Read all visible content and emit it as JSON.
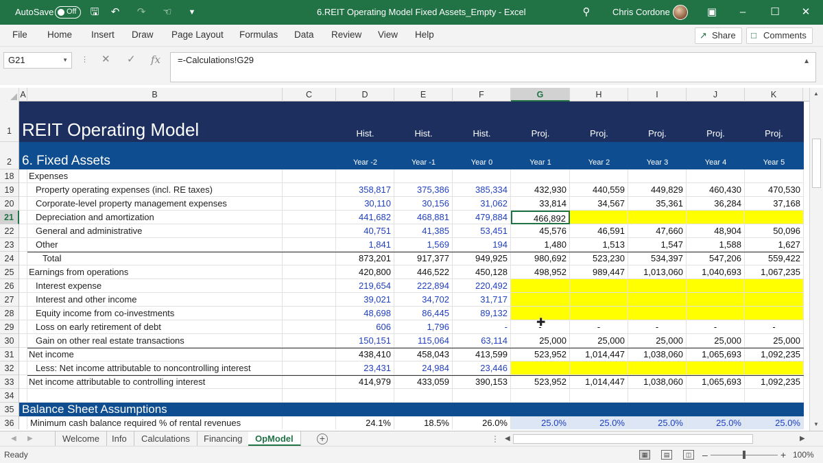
{
  "titlebar": {
    "autosave_label": "AutoSave",
    "autosave_state": "Off",
    "doc_title": "6.REIT Operating Model Fixed Assets_Empty  -  Excel",
    "user_name": "Chris Cordone"
  },
  "ribbon": {
    "tabs": [
      "File",
      "Home",
      "Insert",
      "Draw",
      "Page Layout",
      "Formulas",
      "Data",
      "Review",
      "View",
      "Help"
    ],
    "share_label": "Share",
    "comments_label": "Comments"
  },
  "formula_bar": {
    "name_box": "G21",
    "formula": "=-Calculations!G29"
  },
  "columns": [
    "A",
    "B",
    "C",
    "D",
    "E",
    "F",
    "G",
    "H",
    "I",
    "J",
    "K"
  ],
  "selected_column": "G",
  "header_rows": {
    "title_row_num": "1",
    "title": "REIT Operating Model",
    "period_type": [
      "Hist.",
      "Hist.",
      "Hist.",
      "Proj.",
      "Proj.",
      "Proj.",
      "Proj.",
      "Proj."
    ],
    "section_row_num": "2",
    "section": "6. Fixed Assets",
    "years": [
      "Year -2",
      "Year -1",
      "Year 0",
      "Year 1",
      "Year 2",
      "Year 3",
      "Year 4",
      "Year 5"
    ]
  },
  "rows": [
    {
      "num": "18",
      "label": "Expenses",
      "indent": 0,
      "hist": [
        "",
        "",
        ""
      ],
      "proj": [
        "",
        "",
        "",
        "",
        ""
      ]
    },
    {
      "num": "19",
      "label": "Property operating expenses (incl. RE taxes)",
      "indent": 1,
      "hist": [
        "358,817",
        "375,386",
        "385,334"
      ],
      "proj": [
        "432,930",
        "440,559",
        "449,829",
        "460,430",
        "470,530"
      ]
    },
    {
      "num": "20",
      "label": "Corporate-level property management expenses",
      "indent": 1,
      "hist": [
        "30,110",
        "30,156",
        "31,062"
      ],
      "proj": [
        "33,814",
        "34,567",
        "35,361",
        "36,284",
        "37,168"
      ]
    },
    {
      "num": "21",
      "label": "Depreciation and amortization",
      "indent": 1,
      "hist": [
        "441,682",
        "468,881",
        "479,884"
      ],
      "proj": [
        "466,892",
        "",
        "",
        "",
        ""
      ]
    },
    {
      "num": "22",
      "label": "General and administrative",
      "indent": 1,
      "hist": [
        "40,751",
        "41,385",
        "53,451"
      ],
      "proj": [
        "45,576",
        "46,591",
        "47,660",
        "48,904",
        "50,096"
      ]
    },
    {
      "num": "23",
      "label": "Other",
      "indent": 1,
      "hist": [
        "1,841",
        "1,569",
        "194"
      ],
      "proj": [
        "1,480",
        "1,513",
        "1,547",
        "1,588",
        "1,627"
      ]
    },
    {
      "num": "24",
      "label": "Total",
      "indent": 2,
      "hist": [
        "873,201",
        "917,377",
        "949,925"
      ],
      "proj": [
        "980,692",
        "523,230",
        "534,397",
        "547,206",
        "559,422"
      ]
    },
    {
      "num": "25",
      "label": "Earnings from operations",
      "indent": 0,
      "hist": [
        "420,800",
        "446,522",
        "450,128"
      ],
      "proj": [
        "498,952",
        "989,447",
        "1,013,060",
        "1,040,693",
        "1,067,235"
      ]
    },
    {
      "num": "26",
      "label": "Interest expense",
      "indent": 1,
      "hist": [
        "219,654",
        "222,894",
        "220,492"
      ],
      "proj": [
        "",
        "",
        "",
        "",
        ""
      ]
    },
    {
      "num": "27",
      "label": "Interest and other income",
      "indent": 1,
      "hist": [
        "39,021",
        "34,702",
        "31,717"
      ],
      "proj": [
        "",
        "",
        "",
        "",
        ""
      ]
    },
    {
      "num": "28",
      "label": "Equity income from co-investments",
      "indent": 1,
      "hist": [
        "48,698",
        "86,445",
        "89,132"
      ],
      "proj": [
        "",
        "",
        "",
        "",
        ""
      ]
    },
    {
      "num": "29",
      "label": "Loss on early retirement of debt",
      "indent": 1,
      "hist": [
        "606",
        "1,796",
        "-"
      ],
      "proj": [
        "-",
        "-",
        "-",
        "-",
        "-"
      ]
    },
    {
      "num": "30",
      "label": "Gain on other real estate transactions",
      "indent": 1,
      "hist": [
        "150,151",
        "115,064",
        "63,114"
      ],
      "proj": [
        "25,000",
        "25,000",
        "25,000",
        "25,000",
        "25,000"
      ]
    },
    {
      "num": "31",
      "label": "Net income",
      "indent": 0,
      "hist": [
        "438,410",
        "458,043",
        "413,599"
      ],
      "proj": [
        "523,952",
        "1,014,447",
        "1,038,060",
        "1,065,693",
        "1,092,235"
      ]
    },
    {
      "num": "32",
      "label": "Less: Net income attributable to noncontrolling interest",
      "indent": 1,
      "hist": [
        "23,431",
        "24,984",
        "23,446"
      ],
      "proj": [
        "",
        "",
        "",
        "",
        ""
      ]
    },
    {
      "num": "33",
      "label": "Net income attributable to controlling interest",
      "indent": 0,
      "hist": [
        "414,979",
        "433,059",
        "390,153"
      ],
      "proj": [
        "523,952",
        "1,014,447",
        "1,038,060",
        "1,065,693",
        "1,092,235"
      ]
    },
    {
      "num": "34",
      "label": "",
      "indent": 0,
      "hist": [
        "",
        "",
        ""
      ],
      "proj": [
        "",
        "",
        "",
        "",
        ""
      ]
    }
  ],
  "balance_section": {
    "num": "35",
    "title": "Balance Sheet Assumptions"
  },
  "row36": {
    "num": "36",
    "label": "Minimum cash balance required % of rental revenues",
    "hist": [
      "24.1%",
      "18.5%",
      "26.0%"
    ],
    "proj": [
      "25.0%",
      "25.0%",
      "25.0%",
      "25.0%",
      "25.0%"
    ]
  },
  "sheets": [
    "Welcome",
    "Info",
    "Calculations",
    "Financing",
    "OpModel"
  ],
  "active_sheet": "OpModel",
  "status": {
    "ready": "Ready",
    "zoom": "100%"
  },
  "colors": {
    "excel_green": "#217346",
    "navy_header": "#1c2f5e",
    "section_blue": "#0e4d8f",
    "input_blue": "#1f3fbf",
    "highlight_yellow": "#ffff00",
    "assumption_fill": "#dce6f5"
  }
}
